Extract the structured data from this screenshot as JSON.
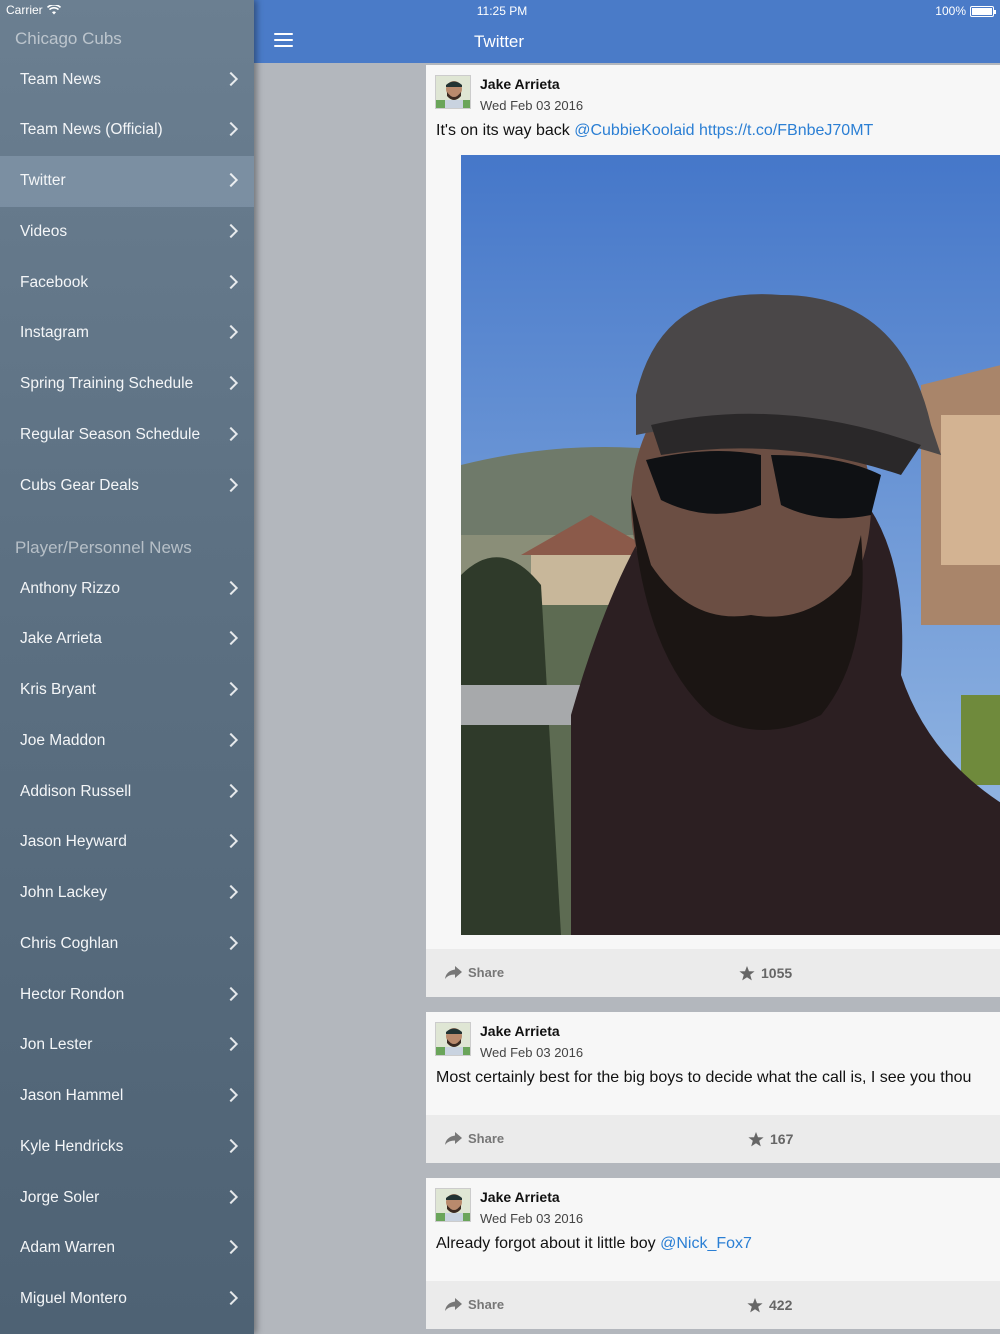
{
  "status": {
    "carrier": "Carrier",
    "time": "11:25 PM",
    "battery": "100%"
  },
  "sidebar": {
    "team_header": "Chicago Cubs",
    "team_items": [
      {
        "label": "Team News"
      },
      {
        "label": "Team News (Official)"
      },
      {
        "label": "Twitter",
        "active": true
      },
      {
        "label": "Videos"
      },
      {
        "label": "Facebook"
      },
      {
        "label": "Instagram"
      },
      {
        "label": "Spring Training Schedule"
      },
      {
        "label": "Regular Season Schedule"
      },
      {
        "label": "Cubs Gear Deals"
      }
    ],
    "players_header": "Player/Personnel News",
    "player_items": [
      {
        "label": "Anthony Rizzo"
      },
      {
        "label": "Jake Arrieta"
      },
      {
        "label": "Kris Bryant"
      },
      {
        "label": "Joe Maddon"
      },
      {
        "label": "Addison Russell"
      },
      {
        "label": "Jason Heyward"
      },
      {
        "label": "John Lackey"
      },
      {
        "label": "Chris Coghlan"
      },
      {
        "label": "Hector Rondon"
      },
      {
        "label": "Jon Lester"
      },
      {
        "label": "Jason Hammel"
      },
      {
        "label": "Kyle Hendricks"
      },
      {
        "label": "Jorge Soler"
      },
      {
        "label": "Adam Warren"
      },
      {
        "label": "Miguel Montero"
      }
    ]
  },
  "header": {
    "title": "Twitter",
    "menu_icon": "hamburger-menu-icon"
  },
  "tweets": [
    {
      "author": "Jake Arrieta",
      "date": "Wed Feb 03 2016",
      "text": "It's on its way back ",
      "mention": "@CubbieKoolaid",
      "url": " https://t.co/FBnbeJ70MT",
      "share": "Share",
      "likes": "1055"
    },
    {
      "author": "Jake Arrieta",
      "date": "Wed Feb 03 2016",
      "text": "Most certainly best for the big boys to decide what the call is, I see you thou",
      "share": "Share",
      "likes": "167"
    },
    {
      "author": "Jake Arrieta",
      "date": "Wed Feb 03 2016",
      "text": "Already forgot about it little boy ",
      "mention": "@Nick_Fox7",
      "share": "Share",
      "likes": "422"
    }
  ]
}
